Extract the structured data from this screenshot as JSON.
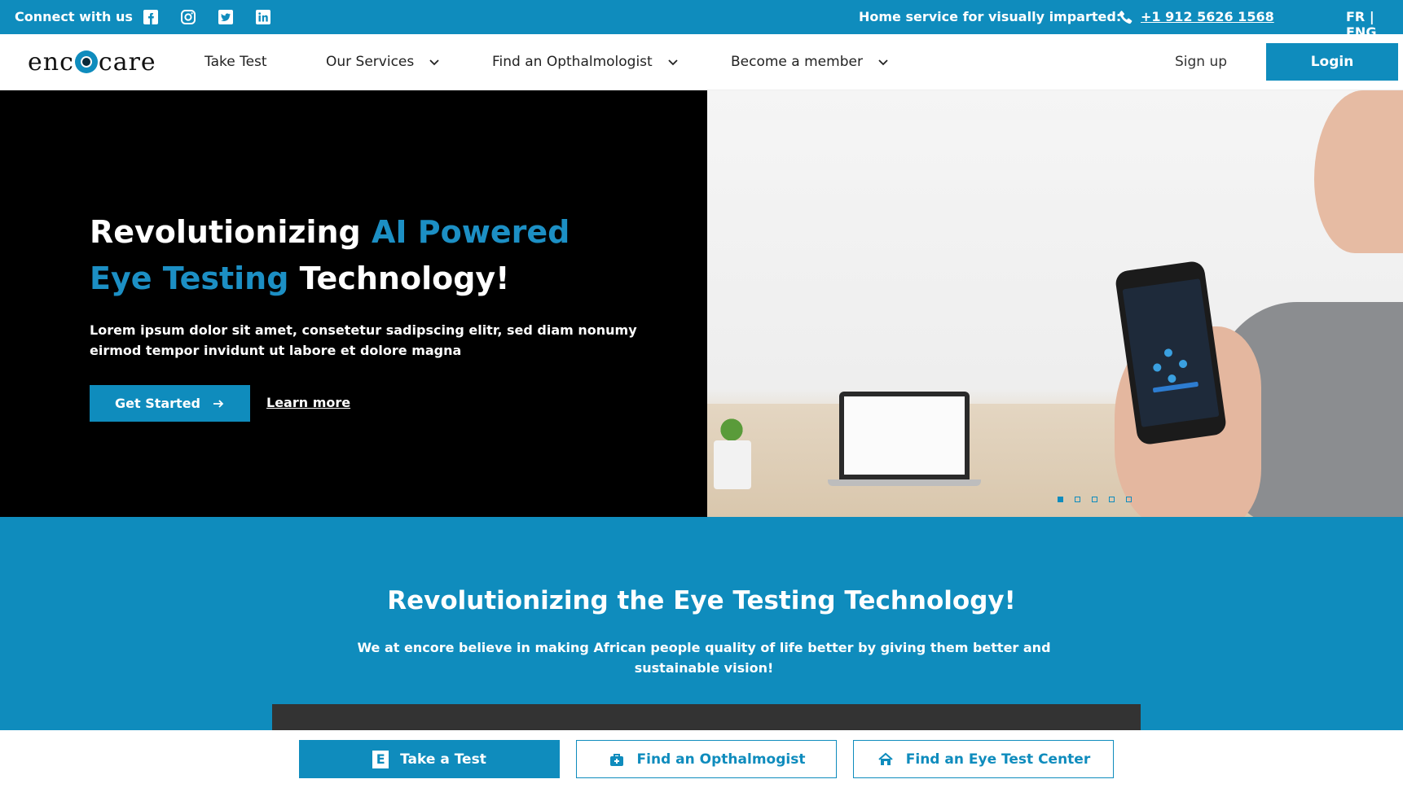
{
  "topbar": {
    "connect_label": "Connect with us",
    "social_icons": [
      "facebook-icon",
      "instagram-icon",
      "twitter-icon",
      "linkedin-icon"
    ],
    "home_service_label": "Home service for visually imparted:",
    "phone_number": "+1 912 5626 1568",
    "language": "FR | ENG"
  },
  "nav": {
    "logo_prefix": "enc",
    "logo_suffix": "care",
    "items": [
      {
        "label": "Take Test"
      },
      {
        "label": "Our Services"
      },
      {
        "label": "Find an Opthalmologist"
      },
      {
        "label": "Become a member"
      }
    ],
    "signup_label": "Sign up",
    "login_label": "Login"
  },
  "hero": {
    "title_part1": "Revolutionizing ",
    "title_accent1": "AI Powered",
    "title_accent2": "Eye Testing",
    "title_part2": " Technology!",
    "description": "Lorem ipsum dolor sit amet, consetetur sadipscing elitr, sed diam nonumy eirmod tempor invidunt ut labore et dolore magna",
    "cta_primary": "Get Started",
    "cta_secondary": "Learn more",
    "slide_count": 5,
    "active_slide": 1
  },
  "mission": {
    "title": "Revolutionizing the Eye Testing Technology!",
    "text": "We at encore believe in making African people quality of life better by giving them better and sustainable vision!"
  },
  "bottom_bar": {
    "take_test": "Take a Test",
    "find_ophthalmologist": "Find an Opthalmogist",
    "find_center": "Find an Eye Test Center"
  },
  "colors": {
    "brand": "#0f8cbd",
    "hero_bg": "#000000",
    "accent_text": "#1c8fc4",
    "video_bg": "#333333"
  }
}
